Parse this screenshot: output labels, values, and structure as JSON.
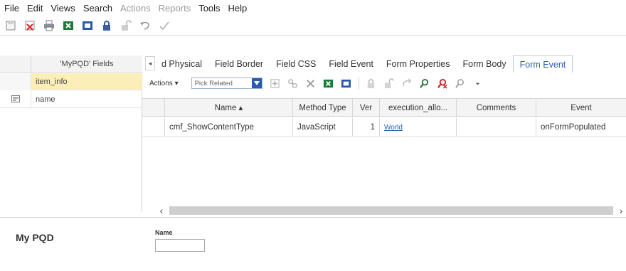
{
  "menu": [
    {
      "label": "File",
      "enabled": true
    },
    {
      "label": "Edit",
      "enabled": true
    },
    {
      "label": "Views",
      "enabled": true
    },
    {
      "label": "Search",
      "enabled": true
    },
    {
      "label": "Actions",
      "enabled": false
    },
    {
      "label": "Reports",
      "enabled": false
    },
    {
      "label": "Tools",
      "enabled": true
    },
    {
      "label": "Help",
      "enabled": true
    }
  ],
  "toolbar_icons": [
    "save-icon",
    "close-icon",
    "print-icon",
    "excel-icon",
    "word-icon",
    "lock-icon",
    "unlock-icon",
    "undo-icon",
    "check-icon"
  ],
  "left_panel": {
    "title": "'MyPQD' Fields",
    "rows": [
      {
        "label": "item_info",
        "selected": true,
        "icon": ""
      },
      {
        "label": "name",
        "selected": false,
        "icon": "field-icon"
      }
    ]
  },
  "tabs": {
    "scroll_glyph": "◂",
    "items": [
      {
        "label": "d Physical"
      },
      {
        "label": "Field Border"
      },
      {
        "label": "Field CSS"
      },
      {
        "label": "Field Event"
      },
      {
        "label": "Form Properties"
      },
      {
        "label": "Form Body"
      },
      {
        "label": "Form Event",
        "active": true
      }
    ]
  },
  "actions_bar": {
    "actions_label": "Actions ▾",
    "pick_related": "Pick Related"
  },
  "grid": {
    "columns": [
      "Name ▴",
      "Method Type",
      "Ver",
      "execution_allo...",
      "Comments",
      "Event"
    ],
    "rows": [
      {
        "name": "cmf_ShowContentType",
        "method_type": "JavaScript",
        "ver": "1",
        "execution": "World",
        "comments": "",
        "event": "onFormPopulated"
      }
    ]
  },
  "form": {
    "title": "My PQD",
    "field_label": "Name",
    "field_value": ""
  },
  "colors": {
    "selected_row": "#fbeeb8",
    "active_tab": "#2b5fae",
    "link": "#2b5fae"
  }
}
